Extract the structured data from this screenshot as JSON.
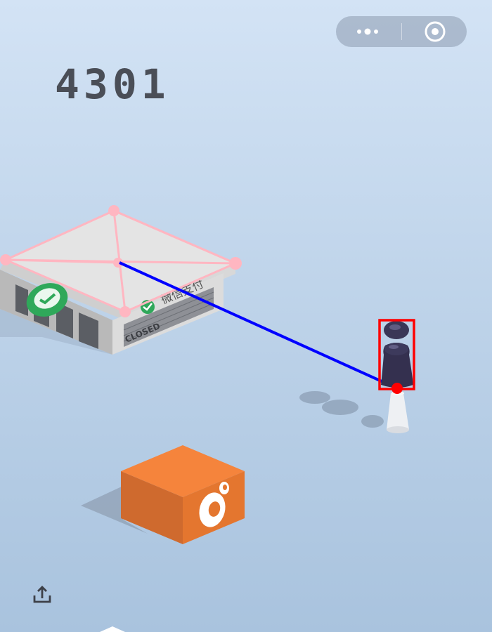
{
  "hud": {
    "score": "4301"
  },
  "capsule": {
    "more_icon": "more-dots-icon",
    "close_icon": "target-circle-icon"
  },
  "scene": {
    "store_sign": "微信支付",
    "store_closed": "CLOSED",
    "wechat_logo_icon": "wechat-pay-icon",
    "gift_box_color": "#f0823a"
  },
  "overlays": {
    "line_color": "#0000ff",
    "bbox_color": "#ff0000",
    "wireframe_color": "#ffb6c1"
  },
  "share_icon": "share-upload-icon"
}
